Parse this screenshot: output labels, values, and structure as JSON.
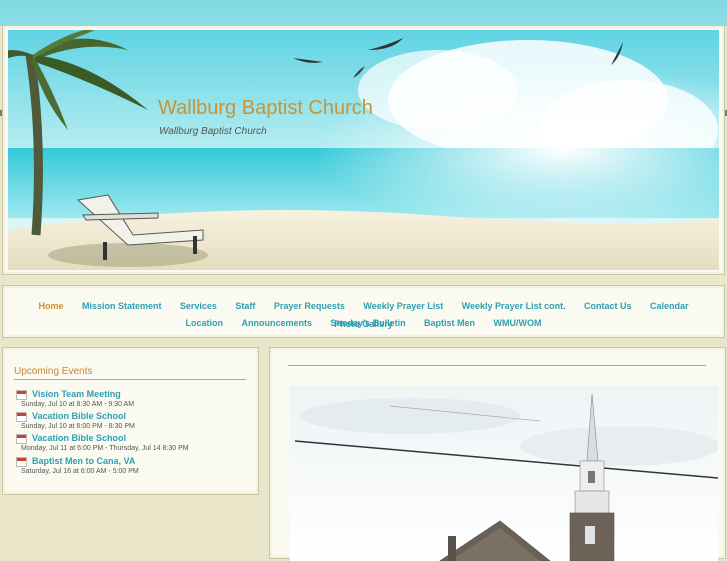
{
  "site": {
    "title": "Wallburg Baptist Church",
    "subtitle": "Wallburg Baptist Church"
  },
  "nav": {
    "row1": [
      "Home",
      "Mission Statement",
      "Services",
      "Staff",
      "Prayer Requests",
      "Weekly Prayer List",
      "Weekly Prayer List cont.",
      "Contact Us",
      "Calendar",
      "Photo Gallery"
    ],
    "row2": [
      "Location",
      "Announcements",
      "Sunday's Bulletin",
      "Baptist Men",
      "WMU/WOM"
    ],
    "active": "Home"
  },
  "events": {
    "heading": "Upcoming Events",
    "items": [
      {
        "name": "Vision Team Meeting",
        "when": "Sunday, Jul 10 at 8:30 AM - 9:30 AM"
      },
      {
        "name": "Vacation Bible School",
        "when": "Sunday, Jul 10 at 6:00 PM - 8:30 PM"
      },
      {
        "name": "Vacation Bible School",
        "when": "Monday, Jul 11 at 6:00 PM - Thursday, Jul 14 8:30 PM"
      },
      {
        "name": "Baptist Men to Cana, VA",
        "when": "Saturday, Jul 16 at 6:00 AM - 5:00 PM"
      }
    ]
  },
  "icons": {
    "event": "calendar-icon"
  },
  "colors": {
    "accent_link": "#2e9fb4",
    "active_nav": "#d28e2c",
    "title": "#c79438",
    "background": "#e9e6c9"
  }
}
